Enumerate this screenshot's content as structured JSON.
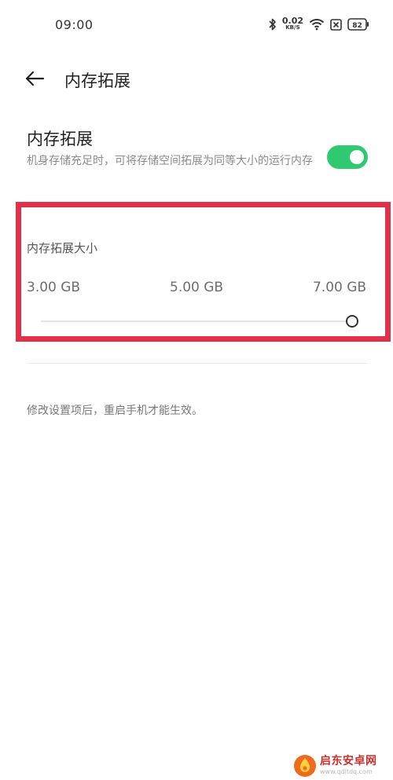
{
  "status_bar": {
    "time": "09:00",
    "net_speed_value": "0.02",
    "net_speed_unit": "KB/S",
    "battery": "82",
    "icons": [
      "bluetooth-icon",
      "wifi-icon",
      "sim-off-icon",
      "battery-icon"
    ]
  },
  "header": {
    "back_icon": "arrow-left-icon",
    "title": "内存拓展"
  },
  "memory_expansion": {
    "title": "内存拓展",
    "description": "机身存储充足时，可将存储空间拓展为同等大小的运行内存",
    "enabled": true,
    "toggle_color": "#2fc96f"
  },
  "expansion_size": {
    "title": "内存拓展大小",
    "options": [
      "3.00 GB",
      "5.00 GB",
      "7.00 GB"
    ],
    "selected": "7.00 GB",
    "slider_fraction": 1.0
  },
  "note": "修改设置项后，重启手机才能生效。",
  "highlight_color": "#e2304a",
  "watermark": {
    "name": "启东安卓网",
    "url": "www.qdltdq.com"
  }
}
